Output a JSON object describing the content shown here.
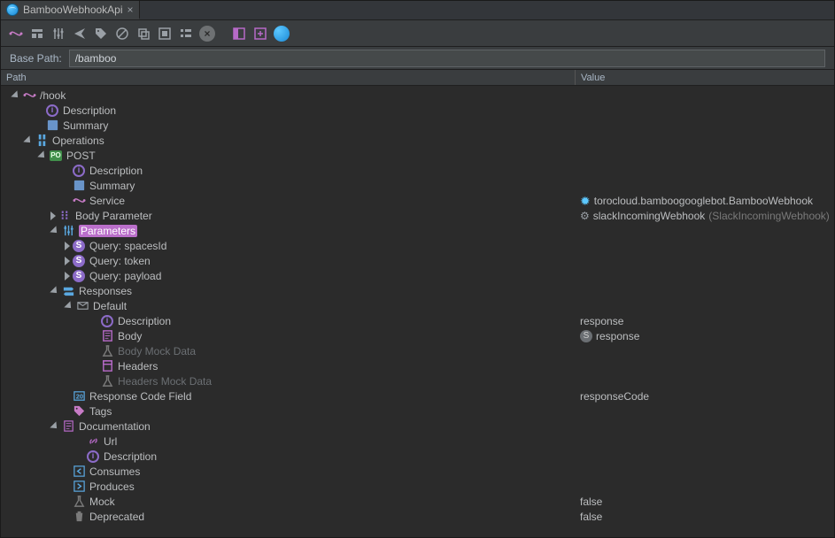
{
  "tab": {
    "title": "BambooWebhookApi"
  },
  "basepath": {
    "label": "Base Path:",
    "value": "/bamboo"
  },
  "headers": {
    "path": "Path",
    "value": "Value"
  },
  "tree": {
    "root": "/hook",
    "description": "Description",
    "summary": "Summary",
    "operations": "Operations",
    "post": "POST",
    "post_description": "Description",
    "post_summary": "Summary",
    "service": "Service",
    "service_value": "torocloud.bamboogooglebot.BambooWebhook",
    "body_parameter": "Body Parameter",
    "body_parameter_value": "slackIncomingWebhook",
    "body_parameter_type": "(SlackIncomingWebhook)",
    "parameters": "Parameters",
    "q_spaces": "Query: spacesId",
    "q_token": "Query: token",
    "q_payload": "Query: payload",
    "responses": "Responses",
    "default": "Default",
    "resp_description": "Description",
    "resp_description_value": "response",
    "resp_body": "Body",
    "resp_body_value": "response",
    "body_mock": "Body Mock Data",
    "resp_headers": "Headers",
    "headers_mock": "Headers Mock Data",
    "response_code_field": "Response Code Field",
    "response_code_field_value": "responseCode",
    "tags": "Tags",
    "documentation": "Documentation",
    "doc_url": "Url",
    "doc_description": "Description",
    "consumes": "Consumes",
    "produces": "Produces",
    "mock": "Mock",
    "mock_value": "false",
    "deprecated": "Deprecated",
    "deprecated_value": "false"
  }
}
